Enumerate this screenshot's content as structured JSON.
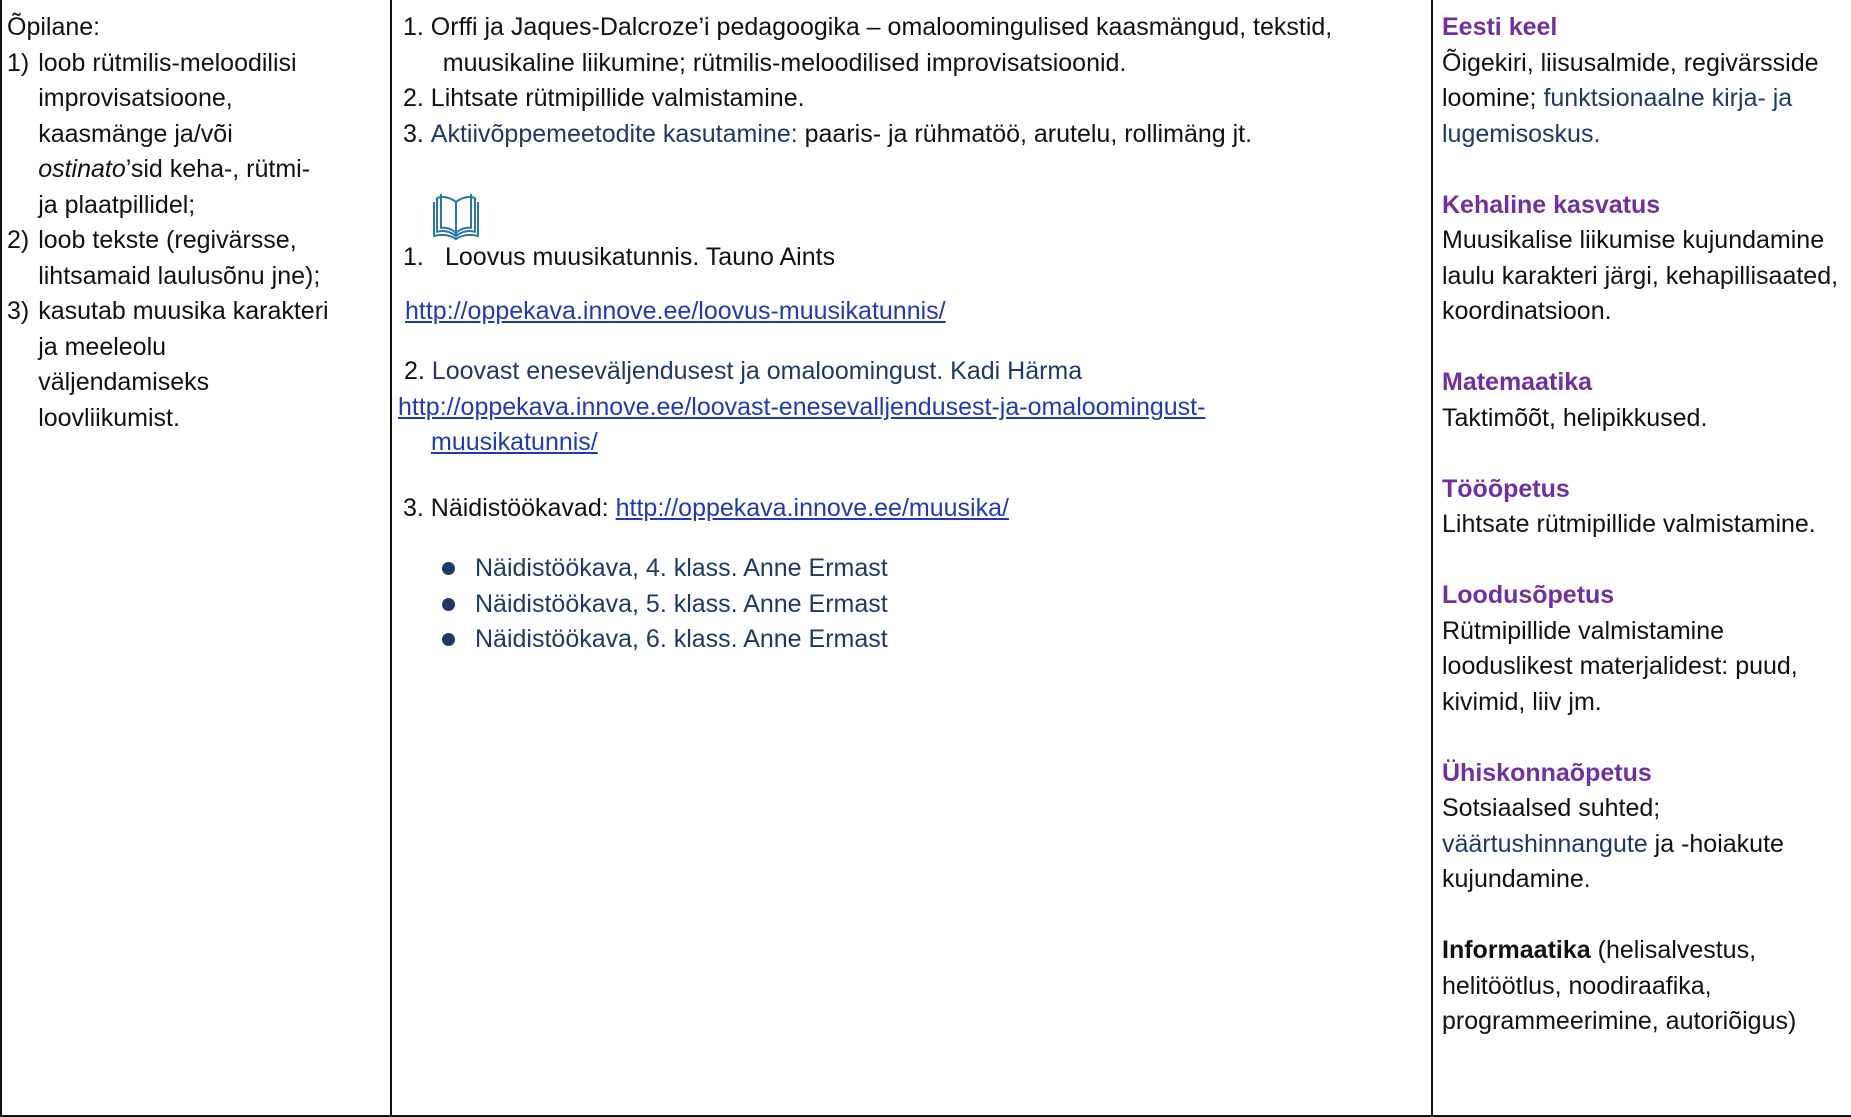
{
  "col1": {
    "heading": "Õpilane:",
    "outcomes": [
      {
        "num": "1) ",
        "lines": [
          "loob rütmilis-meloodilisi",
          "improvisatsioone,",
          "kaasmänge ja/või"
        ],
        "line4_italic": "ostinato",
        "line4_rest": "’sid keha-, rütmi-",
        "line5": "ja plaatpillidel;"
      },
      {
        "num": "2) ",
        "lines": [
          "loob tekste (regivärsse,",
          "lihtsamaid laulusõnu jne);"
        ]
      },
      {
        "num": "3) ",
        "lines": [
          "kasutab muusika karakteri",
          "ja meeleolu",
          "väljendamiseks",
          "loovliikumist."
        ]
      }
    ]
  },
  "col2": {
    "methods": [
      {
        "num": "1. ",
        "line1": "Orffi ja Jaques-Dalcroze’i pedagoogika – omaloomingulised kaasmängud, tekstid,",
        "line2": "muusikaline liikumine; rütmilis-meloodilised improvisatsioonid."
      },
      {
        "num": "2. ",
        "line1": "Lihtsate rütmipillide valmistamine."
      },
      {
        "num": "3. ",
        "blue_part": "Aktiivõppemeetodite kasutamine:",
        "rest": " paaris- ja rühmatöö, arutelu, rollimäng jt."
      }
    ],
    "book_icon": "open-book-icon",
    "resources": {
      "r1_num": "1.",
      "r1_text": "Loovus muusikatunnis. Tauno Aints",
      "r1_link": "http://oppekava.innove.ee/loovus-muusikatunnis/",
      "r2_num": "2. ",
      "r2_text": "Loovast eneseväljendusest ja omaloomingust. Kadi Härma",
      "r2_link_line1": "http://oppekava.innove.ee/loovast-eneseval\u0006jendusest-ja-omaloomingust-",
      "r2_link_line2": "muusikatunnis/",
      "r3_label": "3. Näidistöökavad: ",
      "r3_link": "http://oppekava.innove.ee/muusika/"
    },
    "bullets": [
      "Näidistöökava, 4. klass. Anne Ermast",
      "Näidistöökava, 5. klass. Anne Ermast",
      "Näidistöökava, 6. klass. Anne Ermast"
    ]
  },
  "col3": {
    "subjects": [
      {
        "title": "Eesti keel",
        "desc_plain": "Õigekiri, liisusalmide, regivärsside loomine; ",
        "desc_blue": "funktsionaalne kirja- ja lugemisoskus."
      },
      {
        "title": "Kehaline kasvatus",
        "desc_plain": "Muusikalise liikumise kujundamine laulu karakteri järgi, kehapillisaated, koordinatsioon."
      },
      {
        "title": "Matemaatika",
        "desc_plain": "Taktimõõt, helipikkused."
      },
      {
        "title": "Tööõpetus",
        "desc_plain": "Lihtsate rütmipillide valmistamine."
      },
      {
        "title": "Loodusõpetus",
        "desc_plain": "Rütmipillide valmistamine looduslikest materjalidest: puud, kivimid, liiv jm."
      },
      {
        "title": "Ühiskonnaõpetus",
        "desc_plain": "Sotsiaalsed suhted; ",
        "desc_blue": "väärtushinnangute",
        "desc_after": " ja -hoiakute kujundamine."
      }
    ],
    "last": {
      "title": "Informaatika",
      "desc": " (helisalvestus, helitöötlus, noodiraafika, programmeerimine, autoriõigus)"
    },
    "colors": {
      "subject_title": "#7030a0",
      "blue_text": "#1f3864",
      "link": "#1f3bb3"
    }
  }
}
